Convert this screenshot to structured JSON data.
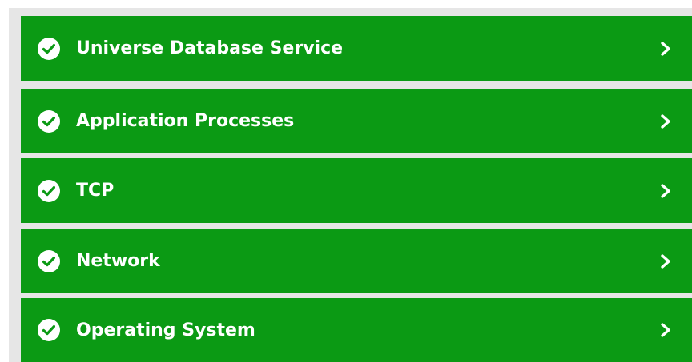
{
  "colors": {
    "row_background": "#0b9a14",
    "text": "#ffffff",
    "panel_background": "#e6e6e6"
  },
  "status_list": {
    "items": [
      {
        "label": "Universe Database Service",
        "status": "ok",
        "status_icon": "check-circle-icon",
        "expand_icon": "chevron-right-icon"
      },
      {
        "label": "Application Processes",
        "status": "ok",
        "status_icon": "check-circle-icon",
        "expand_icon": "chevron-right-icon"
      },
      {
        "label": "TCP",
        "status": "ok",
        "status_icon": "check-circle-icon",
        "expand_icon": "chevron-right-icon"
      },
      {
        "label": "Network",
        "status": "ok",
        "status_icon": "check-circle-icon",
        "expand_icon": "chevron-right-icon"
      },
      {
        "label": "Operating System",
        "status": "ok",
        "status_icon": "check-circle-icon",
        "expand_icon": "chevron-right-icon"
      }
    ]
  }
}
